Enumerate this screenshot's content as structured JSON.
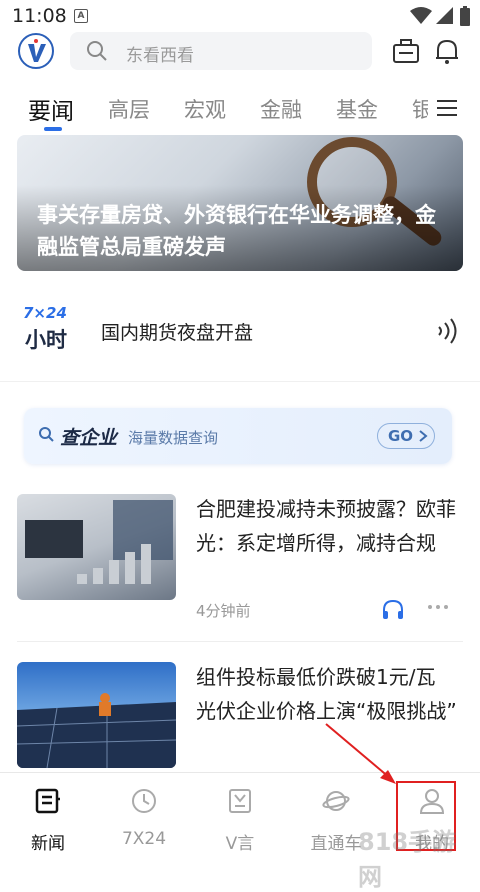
{
  "statusbar": {
    "time": "11:08",
    "notification_letter": "A"
  },
  "header": {
    "search_placeholder": "东看西看"
  },
  "tabs": [
    {
      "label": "要闻"
    },
    {
      "label": "高层"
    },
    {
      "label": "宏观"
    },
    {
      "label": "金融"
    },
    {
      "label": "基金"
    },
    {
      "label": "银"
    }
  ],
  "banner": {
    "title": "事关存量房贷、外资银行在华业务调整，金融监管总局重磅发声"
  },
  "flash": {
    "badge_top": "7×24",
    "badge_bottom": "小时",
    "text": "国内期货夜盘开盘"
  },
  "qiye": {
    "title": "查企业",
    "subtitle": "海量数据查询",
    "go_label": "GO"
  },
  "news": [
    {
      "title": "合肥建投减持未预披露？欧菲光：系定增所得，减持合规",
      "time": "4分钟前"
    },
    {
      "title": "组件投标最低价跌破1元/瓦 光伏企业价格上演“极限挑战”",
      "time": ""
    }
  ],
  "bottom_nav": [
    {
      "label": "新闻",
      "icon": "news-icon"
    },
    {
      "label": "7X24",
      "icon": "clock-icon"
    },
    {
      "label": "V言",
      "icon": "v-note-icon"
    },
    {
      "label": "直通车",
      "icon": "planet-icon"
    },
    {
      "label": "我的",
      "icon": "user-icon"
    }
  ],
  "watermark": "818手游网",
  "colors": {
    "accent": "#2b6ee6",
    "annotation": "#e02020"
  }
}
